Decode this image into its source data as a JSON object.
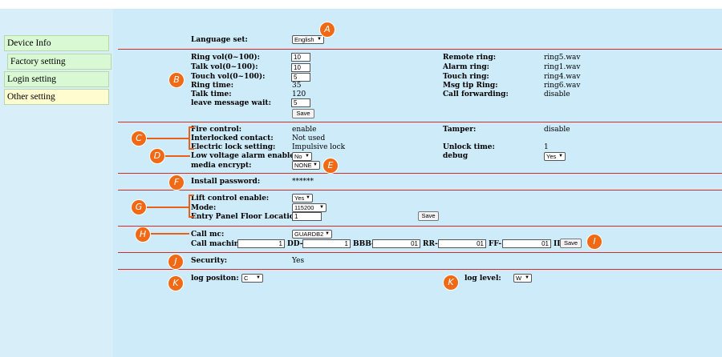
{
  "sidebar": {
    "items": [
      {
        "label": "Device Info"
      },
      {
        "label": "Factory setting"
      },
      {
        "label": "Login setting"
      },
      {
        "label": "Other setting"
      }
    ]
  },
  "language": {
    "label": "Language set:",
    "value": "English"
  },
  "vol": {
    "ring_label": "Ring vol(0~100):",
    "ring_value": "10",
    "talk_label": "Talk vol(0~100):",
    "talk_value": "10",
    "touch_label": "Touch vol(0~100):",
    "touch_value": "5",
    "ring_time_label": "Ring time:",
    "ring_time_value": "35",
    "talk_time_label": "Talk time:",
    "talk_time_value": "120",
    "leave_label": "leave message wait:",
    "leave_value": "5",
    "save": "Save"
  },
  "rings": {
    "remote_label": "Remote ring:",
    "remote_value": "ring5.wav",
    "alarm_label": "Alarm ring:",
    "alarm_value": "ring1.wav",
    "touch_label": "Touch ring:",
    "touch_value": "ring4.wav",
    "msg_label": "Msg tip Ring:",
    "msg_value": "ring6.wav",
    "fwd_label": "Call forwarding:",
    "fwd_value": "disable"
  },
  "control": {
    "fire_label": "Fire control:",
    "fire_value": "enable",
    "interlock_label": "Interlocked contact:",
    "interlock_value": "Not used",
    "lock_label": "Electric lock setting:",
    "lock_value": "Impulsive lock",
    "lowvolt_label": "Low voltage alarm enable",
    "lowvolt_value": "No",
    "encrypt_label": "media encrypt:",
    "encrypt_value": "NONE",
    "tamper_label": "Tamper:",
    "tamper_value": "disable",
    "unlock_label": "Unlock time:",
    "unlock_value": "1",
    "debug_label": "debug",
    "debug_value": "Yes"
  },
  "password": {
    "label": "Install password:",
    "value": "******"
  },
  "lift": {
    "enable_label": "Lift control enable:",
    "enable_value": "Yes",
    "mode_label": "Mode:",
    "mode_value": "115200",
    "floor_label": "Entry Panel Floor Location:",
    "floor_value": "1",
    "save": "Save"
  },
  "callmc": {
    "label": "Call mc:",
    "value": "GUARDB2",
    "machine_label": "Call machine:",
    "machine_value": "1",
    "dd_label": "DD-",
    "dd_value": "1",
    "bbb_label": "BBB-",
    "bbb_value": "01",
    "rr_label": "RR-",
    "rr_value": "01",
    "ff_label": "FF-",
    "ff_value": "01",
    "ii_label": "II",
    "save": "Save"
  },
  "security": {
    "label": "Security:",
    "value": "Yes"
  },
  "log": {
    "pos_label": "log positon:",
    "pos_value": "C",
    "level_label": "log level:",
    "level_value": "W"
  },
  "badges": {
    "a": "A",
    "b": "B",
    "c": "C",
    "d": "D",
    "e": "E",
    "f": "F",
    "g": "G",
    "h": "H",
    "i": "I",
    "j": "J",
    "k1": "K",
    "k2": "K"
  },
  "colors": {
    "accent": "#f06a16",
    "divider": "#d42a2a",
    "background": "#cdebf8"
  }
}
